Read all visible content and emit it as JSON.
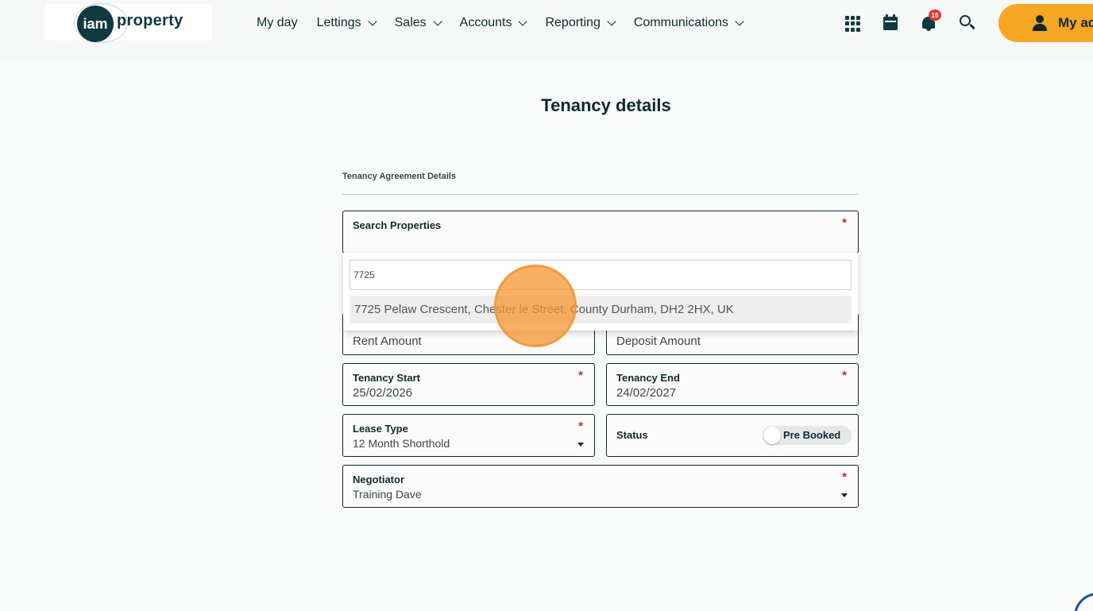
{
  "header": {
    "logo_circle_text": "iam",
    "logo_word": "property",
    "nav": [
      {
        "label": "My day",
        "has_dropdown": false
      },
      {
        "label": "Lettings",
        "has_dropdown": true
      },
      {
        "label": "Sales",
        "has_dropdown": true
      },
      {
        "label": "Accounts",
        "has_dropdown": true
      },
      {
        "label": "Reporting",
        "has_dropdown": true
      },
      {
        "label": "Communications",
        "has_dropdown": true
      }
    ],
    "icons": [
      "apps-grid-icon",
      "calendar-icon",
      "bell-icon",
      "search-icon",
      "user-icon"
    ],
    "notification_count": "16",
    "account_label": "My ac",
    "account_color": "#f6a622"
  },
  "main": {
    "title": "Tenancy details",
    "section_label": "Tenancy Agreement Details",
    "search_properties": {
      "label": "Search Properties",
      "required_mark": "*"
    },
    "dropdown": {
      "query": "7725",
      "option": "7725 Pelaw Crescent, Chester le Street, County Durham, DH2 2HX, UK"
    },
    "rent_amount": {
      "placeholder": "Rent Amount"
    },
    "deposit_amount": {
      "placeholder": "Deposit Amount"
    },
    "tenancy_start": {
      "label": "Tenancy Start",
      "value": "25/02/2026",
      "required_mark": "*"
    },
    "tenancy_end": {
      "label": "Tenancy End",
      "value": "24/02/2027",
      "required_mark": "*"
    },
    "lease_type": {
      "label": "Lease Type",
      "value": "12 Month Shorthold",
      "required_mark": "*"
    },
    "status": {
      "label": "Status",
      "toggle_label": "Pre Booked",
      "toggle_on": false
    },
    "negotiator": {
      "label": "Negotiator",
      "value": "Training Dave",
      "required_mark": "*"
    }
  },
  "colors": {
    "brand_dark": "#0f3b40",
    "required": "#c62828",
    "accent": "#f6a622"
  }
}
